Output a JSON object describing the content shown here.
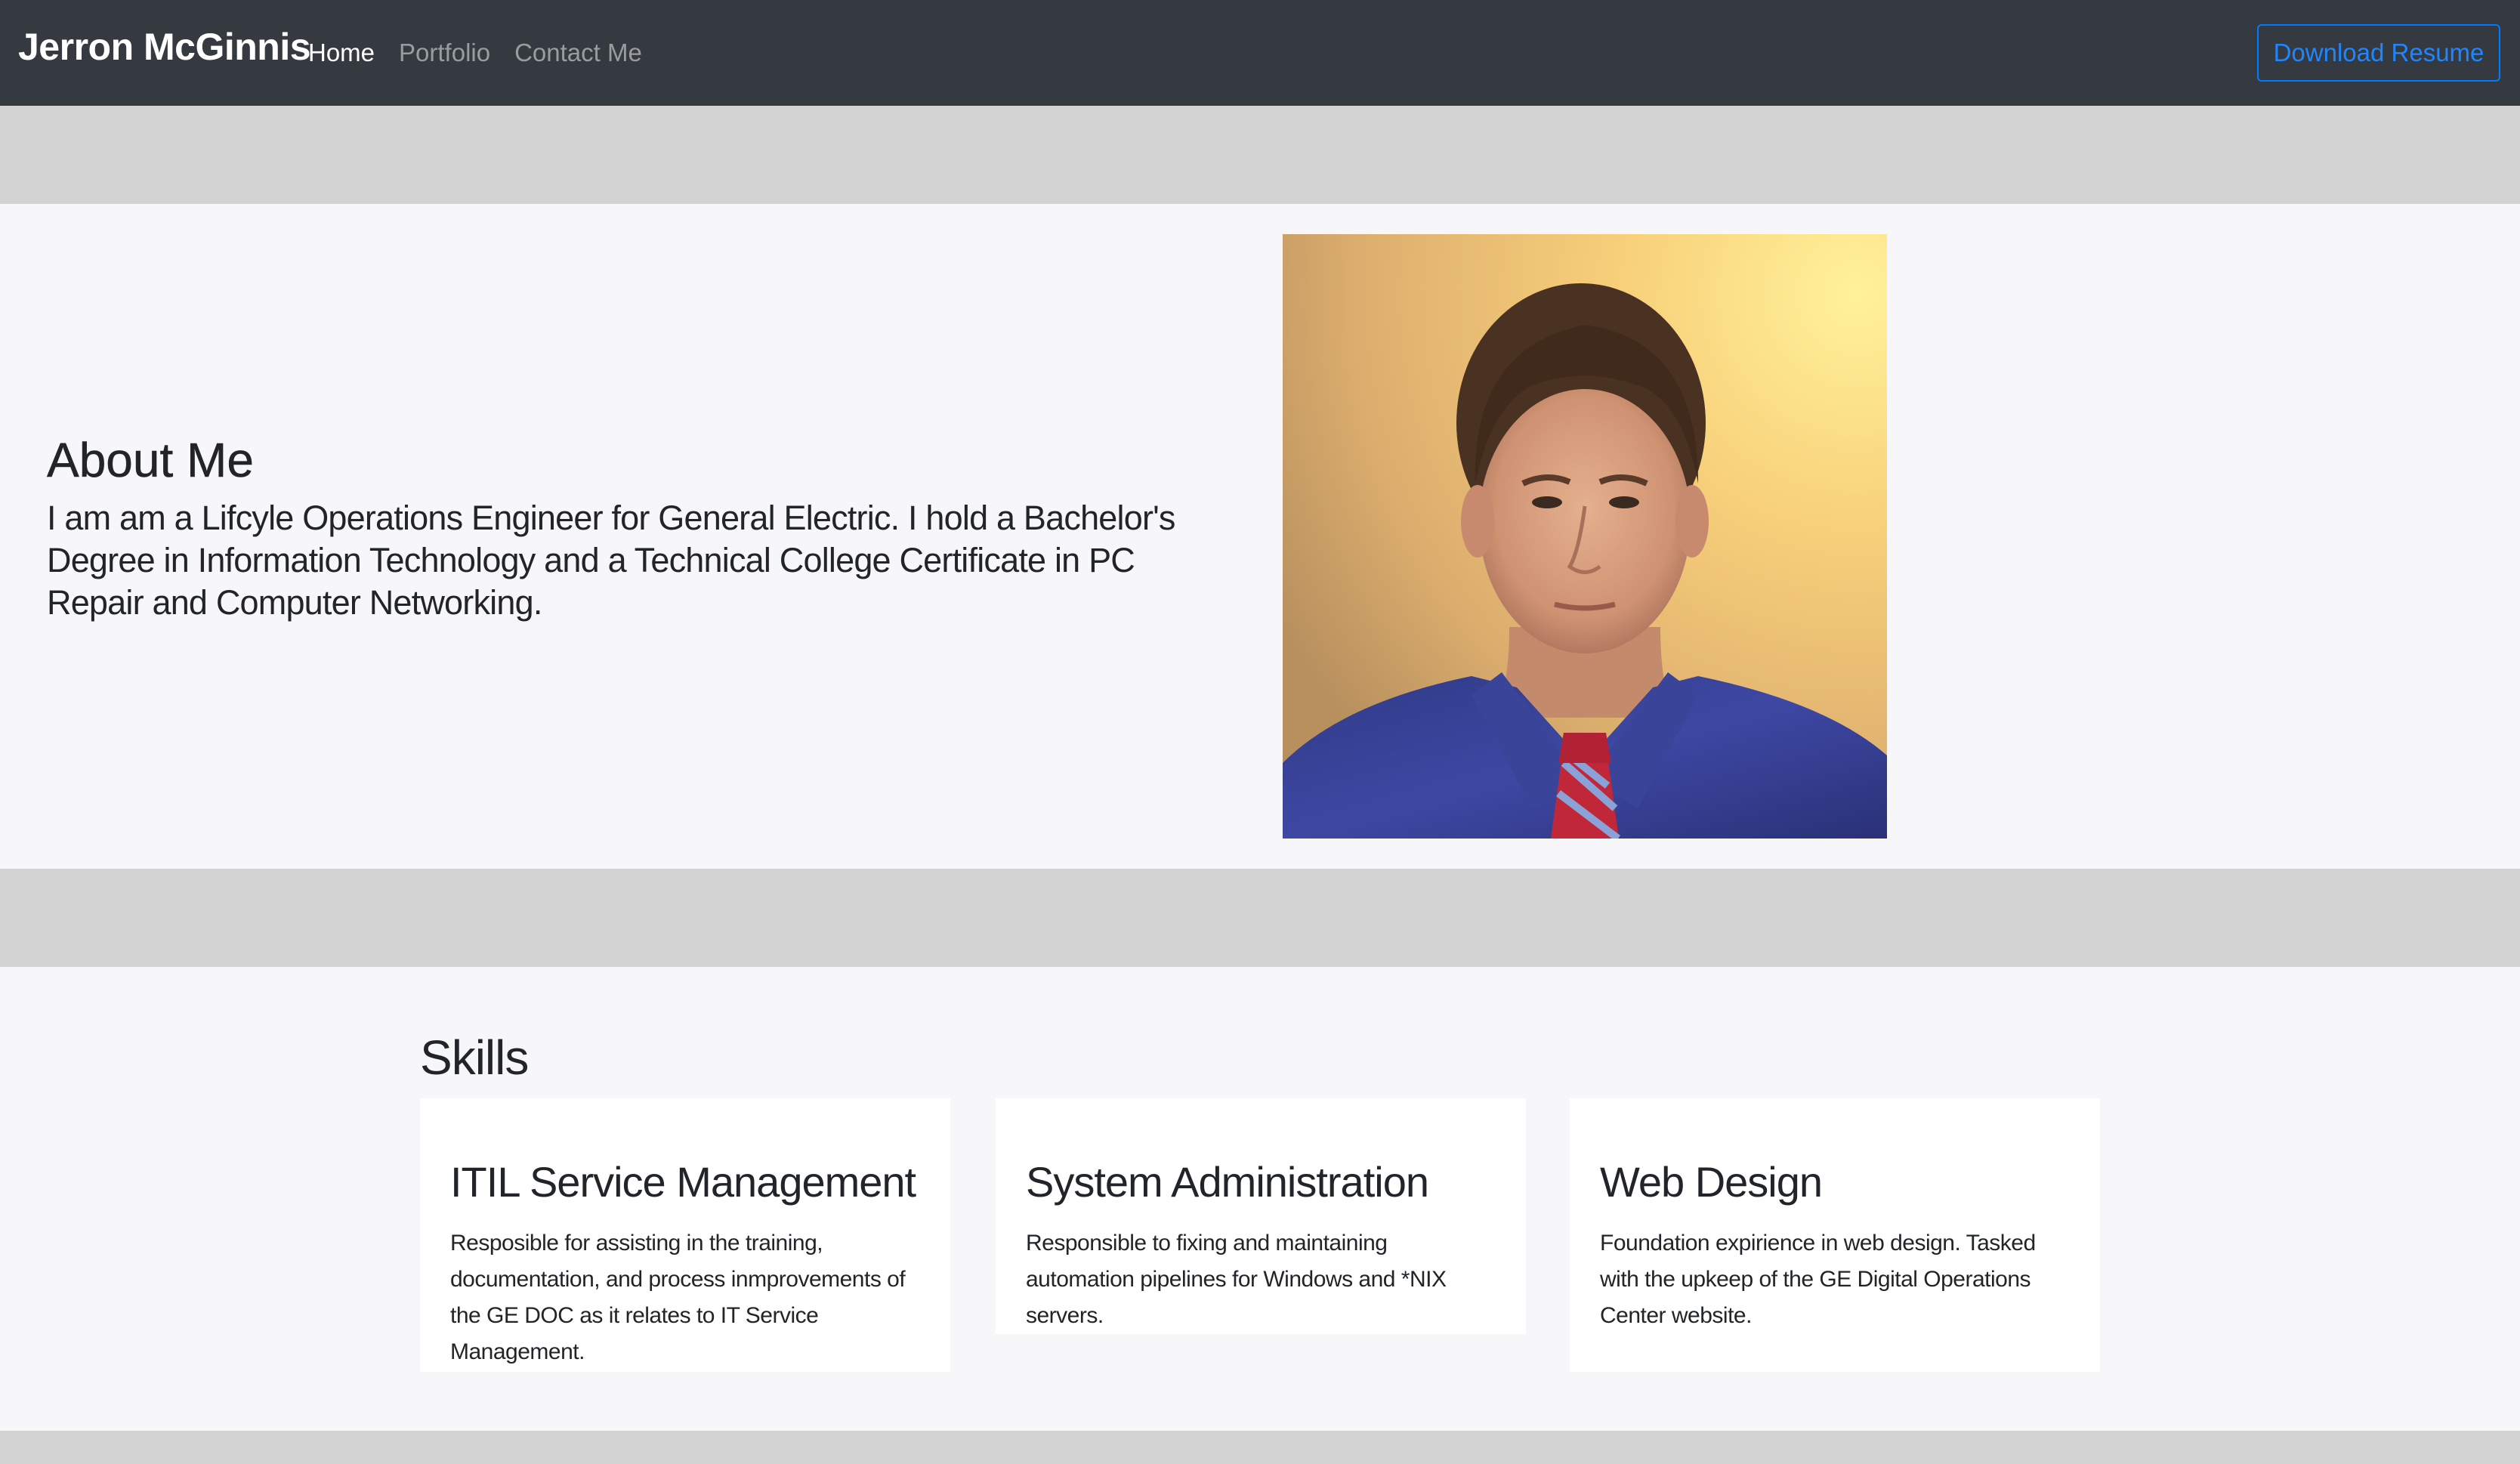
{
  "navbar": {
    "brand": "Jerron McGinnis",
    "links": [
      {
        "label": "Home",
        "active": true
      },
      {
        "label": "Portfolio",
        "active": false
      },
      {
        "label": "Contact Me",
        "active": false
      }
    ],
    "resume_button": "Download Resume"
  },
  "about": {
    "title": "About Me",
    "body": "I am am a Lifcyle Operations Engineer for General Electric. I hold a Bachelor's Degree in Information Technology and a Technical College Certificate in PC Repair and Computer Networking."
  },
  "skills": {
    "title": "Skills",
    "cards": [
      {
        "title": "ITIL Service Management",
        "text": "Resposible for assisting in the training, documentation, and process inmprovements of the GE DOC as it relates to IT Service Management."
      },
      {
        "title": "System Administration",
        "text": "Responsible to fixing and maintaining automation pipelines for Windows and *NIX servers."
      },
      {
        "title": "Web Design",
        "text": "Foundation expirience in web design. Tasked with the upkeep of the GE Digital Operations Center website."
      }
    ]
  },
  "colors": {
    "navbar_bg": "#343a40",
    "section_bg": "#f7f7f9",
    "page_bg": "#d3d3d3",
    "accent": "#007bff"
  }
}
